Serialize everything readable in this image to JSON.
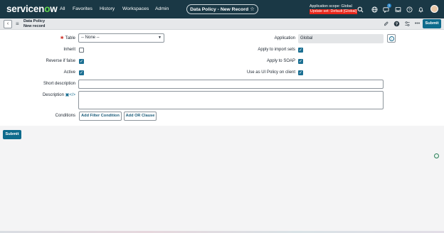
{
  "brand": {
    "logo_pre": "servicen",
    "logo_o": "o",
    "logo_post": "w"
  },
  "nav": {
    "items": [
      "All",
      "Favorites",
      "History",
      "Workspaces",
      "Admin"
    ]
  },
  "record_pill": {
    "label": "Data Policy - New Record",
    "star": "☆"
  },
  "scope": {
    "line1": "Application scope: Global",
    "line2": "Update set: Default [Global]"
  },
  "notification_count": "1",
  "form_header": {
    "title": "Data Policy",
    "subtitle": "New record",
    "submit": "Submit"
  },
  "form": {
    "table": {
      "label": "Table",
      "value": "-- None --"
    },
    "application": {
      "label": "Application",
      "value": "Global"
    },
    "inherit": {
      "label": "Inherit",
      "checked": false
    },
    "apply_import_sets": {
      "label": "Apply to import sets",
      "checked": true
    },
    "reverse_if_false": {
      "label": "Reverse if false",
      "checked": true
    },
    "apply_soap": {
      "label": "Apply to SOAP",
      "checked": true
    },
    "active": {
      "label": "Active",
      "checked": true
    },
    "use_ui_policy": {
      "label": "Use as UI Policy on client",
      "checked": true
    },
    "short_description": {
      "label": "Short description",
      "value": ""
    },
    "description": {
      "label": "Description",
      "value": ""
    },
    "conditions": {
      "label": "Conditions",
      "add_filter": "Add Filter Condition",
      "add_or": "Add OR Clause"
    }
  },
  "footer": {
    "submit": "Submit"
  },
  "colors": {
    "nav_bg": "#1a3845",
    "accent": "#0e6b8c",
    "logo_green": "#62d84e",
    "scope_warning": "#e8261a"
  }
}
